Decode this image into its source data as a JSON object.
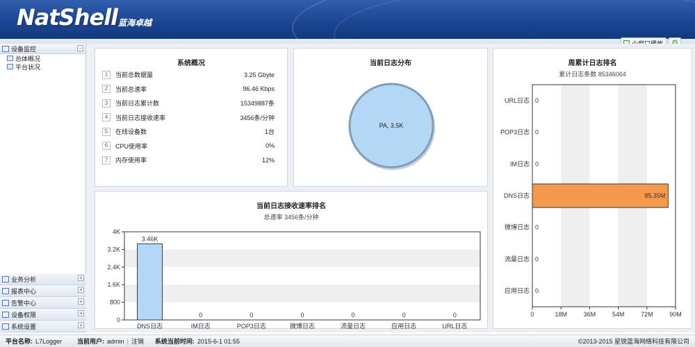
{
  "header": {
    "logo": "NatShell",
    "logo_sub": "蓝海卓越"
  },
  "toolbar": {
    "popup_label": "小窗口播放",
    "settings_icon": "gear-icon"
  },
  "sidebar": {
    "top_group": {
      "label": "设备监控",
      "toggle": "−",
      "items": [
        {
          "label": "总体概况"
        },
        {
          "label": "平台状况"
        }
      ]
    },
    "groups": [
      {
        "label": "业务分析",
        "toggle": "+"
      },
      {
        "label": "报表中心",
        "toggle": "+"
      },
      {
        "label": "告警中心",
        "toggle": "+"
      },
      {
        "label": "设备权限",
        "toggle": "+"
      },
      {
        "label": "系统设置",
        "toggle": "+"
      }
    ]
  },
  "overview": {
    "title": "系统概况",
    "rows": [
      {
        "num": "1",
        "label": "当前总数据量",
        "value": "3.25 Gbyte"
      },
      {
        "num": "2",
        "label": "当前总速率",
        "value": "96.46 Kbps"
      },
      {
        "num": "3",
        "label": "当前日志累计数",
        "value": "15349887条"
      },
      {
        "num": "4",
        "label": "当前日志接收速率",
        "value": "3456条/分钟"
      },
      {
        "num": "5",
        "label": "在线设备数",
        "value": "1台"
      },
      {
        "num": "6",
        "label": "CPU使用率",
        "value": "0%"
      },
      {
        "num": "7",
        "label": "内存使用率",
        "value": "12%"
      }
    ]
  },
  "distribution": {
    "title": "当前日志分布"
  },
  "rate": {
    "title": "当前日志接收速率排名",
    "subtitle": "总速率 3456条/分钟"
  },
  "weekly": {
    "title": "周累计日志排名",
    "subtitle": "累计日志条数 85346064"
  },
  "footer": {
    "platform_label": "平台名称:",
    "platform_value": "L7Logger",
    "user_label": "当前用户:",
    "user_value": "admin",
    "logout": "注销",
    "time_label": "系统当前时间:",
    "time_value": "2015-6-1 01:55",
    "copyright": "©2013-2015 星锐蓝海网络科技有限公司"
  },
  "chart_data": [
    {
      "type": "pie",
      "title": "当前日志分布",
      "slices": [
        {
          "label": "PA, 3.5K",
          "name": "PA",
          "value": 3500
        }
      ],
      "colors": {
        "fill": "#b3d7f5",
        "stroke": "#7f9fb8"
      }
    },
    {
      "type": "bar",
      "title": "当前日志接收速率排名",
      "subtitle": "总速率 3456条/分钟",
      "categories": [
        "DNS日志",
        "IM日志",
        "POP3日志",
        "微博日志",
        "流量日志",
        "应用日志",
        "URL日志"
      ],
      "values": [
        3456,
        0,
        0,
        0,
        0,
        0,
        0
      ],
      "value_labels": [
        "3.46K",
        "0",
        "0",
        "0",
        "0",
        "0",
        "0"
      ],
      "ylim": [
        0,
        4000
      ],
      "yticks": [
        0,
        800,
        1600,
        2400,
        3200,
        4000
      ],
      "ytick_labels": [
        "0",
        "800",
        "1.6K",
        "2.4K",
        "3.2K",
        "4K"
      ],
      "colors": {
        "bar": "#b3d7f5",
        "bar_stroke": "#3a3a3a",
        "band": "#efefef"
      }
    },
    {
      "type": "bar",
      "orientation": "horizontal",
      "title": "周累计日志排名",
      "subtitle": "累计日志条数 85346064",
      "categories": [
        "URL日志",
        "POP3日志",
        "IM日志",
        "DNS日志",
        "微博日志",
        "流量日志",
        "应用日志"
      ],
      "values": [
        0,
        0,
        0,
        85346064,
        0,
        0,
        0
      ],
      "value_labels": [
        "0",
        "0",
        "0",
        "85.35M",
        "0",
        "0",
        "0"
      ],
      "xlim": [
        0,
        90000000
      ],
      "xticks": [
        0,
        18000000,
        36000000,
        54000000,
        72000000,
        90000000
      ],
      "xtick_labels": [
        "0",
        "18M",
        "36M",
        "54M",
        "72M",
        "90M"
      ],
      "colors": {
        "bar": "#f59a4c",
        "bar_stroke": "#3a3a3a",
        "band": "#efefef"
      }
    }
  ]
}
